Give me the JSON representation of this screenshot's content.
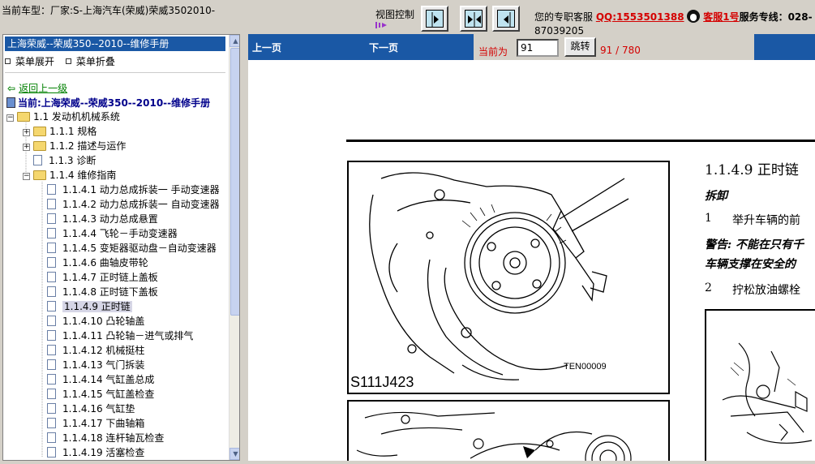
{
  "top": {
    "vehicle_text": "当前车型：厂家:S-上海汽车(荣威)荣威3502010-",
    "view_label": "视图控制",
    "service_prefix": "您的专职客服",
    "qq": "QQ:1553501388",
    "kefu": "客服1号",
    "hotline_label": "服务专线：028-",
    "hotline_rest": "87039205"
  },
  "sidebar": {
    "title": "上海荣威--荣威350--2010--维修手册",
    "menu_expand": "菜单展开",
    "menu_collapse": "菜单折叠",
    "back": "返回上一级",
    "current": "当前:上海荣威--荣威350--2010--维修手册",
    "tree": [
      {
        "label": "1.1 发动机机械系统",
        "level": 0,
        "type": "folder-open",
        "toggle": "−"
      },
      {
        "label": "1.1.1 规格",
        "level": 1,
        "type": "folder",
        "toggle": "+"
      },
      {
        "label": "1.1.2 描述与运作",
        "level": 1,
        "type": "folder",
        "toggle": "+"
      },
      {
        "label": "1.1.3 诊断",
        "level": 1,
        "type": "doc"
      },
      {
        "label": "1.1.4 维修指南",
        "level": 1,
        "type": "folder-open",
        "toggle": "−"
      },
      {
        "label": "1.1.4.1 动力总成拆装一 手动变速器",
        "level": 2,
        "type": "doc"
      },
      {
        "label": "1.1.4.2 动力总成拆装一 自动变速器",
        "level": 2,
        "type": "doc"
      },
      {
        "label": "1.1.4.3 动力总成悬置",
        "level": 2,
        "type": "doc"
      },
      {
        "label": "1.1.4.4 飞轮－手动变速器",
        "level": 2,
        "type": "doc"
      },
      {
        "label": "1.1.4.5 变矩器驱动盘－自动变速器",
        "level": 2,
        "type": "doc"
      },
      {
        "label": "1.1.4.6 曲轴皮带轮",
        "level": 2,
        "type": "doc"
      },
      {
        "label": "1.1.4.7 正时链上盖板",
        "level": 2,
        "type": "doc"
      },
      {
        "label": "1.1.4.8 正时链下盖板",
        "level": 2,
        "type": "doc"
      },
      {
        "label": "1.1.4.9 正时链",
        "level": 2,
        "type": "doc",
        "selected": true
      },
      {
        "label": "1.1.4.10 凸轮轴盖",
        "level": 2,
        "type": "doc"
      },
      {
        "label": "1.1.4.11 凸轮轴－进气或排气",
        "level": 2,
        "type": "doc"
      },
      {
        "label": "1.1.4.12 机械挺柱",
        "level": 2,
        "type": "doc"
      },
      {
        "label": "1.1.4.13 气门拆装",
        "level": 2,
        "type": "doc"
      },
      {
        "label": "1.1.4.14 气缸盖总成",
        "level": 2,
        "type": "doc"
      },
      {
        "label": "1.1.4.15 气缸盖检查",
        "level": 2,
        "type": "doc"
      },
      {
        "label": "1.1.4.16 气缸垫",
        "level": 2,
        "type": "doc"
      },
      {
        "label": "1.1.4.17 下曲轴箱",
        "level": 2,
        "type": "doc"
      },
      {
        "label": "1.1.4.18 连杆轴瓦检查",
        "level": 2,
        "type": "doc"
      },
      {
        "label": "1.1.4.19 活塞检查",
        "level": 2,
        "type": "doc"
      }
    ]
  },
  "nav": {
    "prev": "上一页",
    "next": "下一页",
    "current_label": "当前为",
    "page_value": "91",
    "jump": "跳转",
    "pages": "91 / 780"
  },
  "doc": {
    "heading": "1.1.4.9 正时链",
    "section": "拆卸",
    "step1_num": "1",
    "step1": "举升车辆的前",
    "warn_line1": "警告: 不能在只有千",
    "warn_line2": "车辆支撑在安全的",
    "step2_num": "2",
    "step2": "拧松放油螺栓",
    "fig1_code": "TEN00009",
    "fig1_caption": "S111J423"
  }
}
